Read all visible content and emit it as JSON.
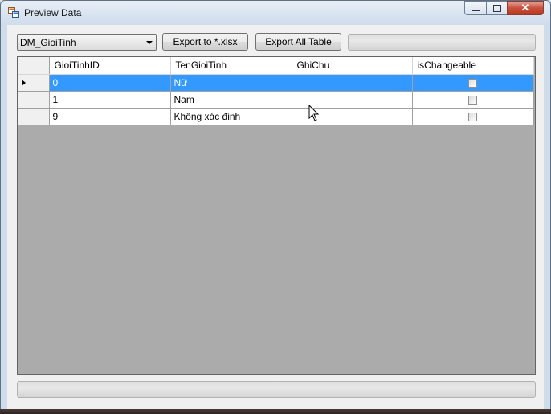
{
  "window": {
    "title": "Preview Data",
    "icon": "app-icon",
    "caption_buttons": [
      "minimize-icon",
      "maximize-icon",
      "close-icon"
    ],
    "close_glyph": "✕"
  },
  "toolbar": {
    "table_select": {
      "selected": "DM_GioiTinh"
    },
    "export_xlsx_label": "Export to *.xlsx",
    "export_all_label": "Export All Table",
    "progress_value": 0
  },
  "grid": {
    "columns": [
      "GioiTinhID",
      "TenGioiTinh",
      "GhiChu",
      "isChangeable"
    ],
    "rows": [
      {
        "GioiTinhID": "0",
        "TenGioiTinh": "Nữ",
        "GhiChu": "",
        "isChangeable": false,
        "selected": true
      },
      {
        "GioiTinhID": "1",
        "TenGioiTinh": "Nam",
        "GhiChu": "",
        "isChangeable": false,
        "selected": false
      },
      {
        "GioiTinhID": "9",
        "TenGioiTinh": "Không xác định",
        "GhiChu": "",
        "isChangeable": false,
        "selected": false
      }
    ]
  },
  "status": {
    "progress_value": 0
  },
  "colors": {
    "selection": "#3399ff",
    "grid_background": "#ababab",
    "close_button": "#c8503c"
  }
}
